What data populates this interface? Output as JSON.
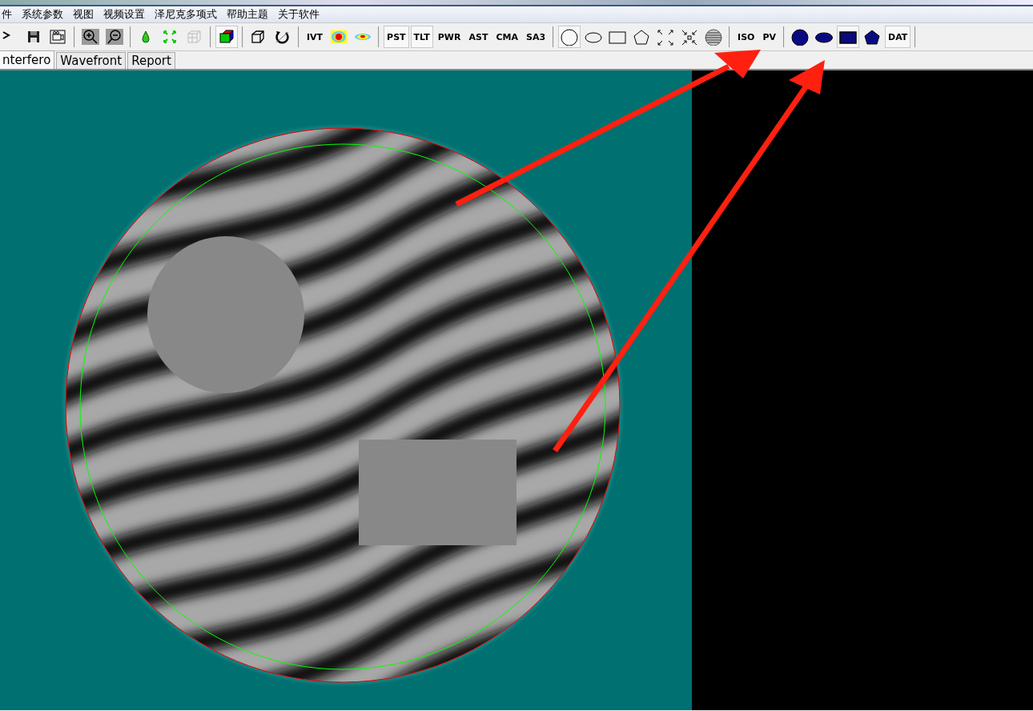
{
  "menu": [
    "件",
    "系统参数",
    "视图",
    "视频设置",
    "泽尼克多项式",
    "帮助主题",
    "关于软件"
  ],
  "toolbar": [
    [
      {
        "kind": "cursor",
        "pressed": false
      },
      {
        "kind": "save",
        "pressed": false
      },
      {
        "kind": "camera",
        "pressed": false
      }
    ],
    [
      {
        "kind": "zoomin",
        "pressed": false
      },
      {
        "kind": "zoomout",
        "pressed": false
      }
    ],
    [
      {
        "kind": "drop",
        "pressed": false
      },
      {
        "kind": "expand",
        "pressed": false
      },
      {
        "kind": "mesh",
        "pressed": false
      }
    ],
    [
      {
        "kind": "cube",
        "pressed": true
      }
    ],
    [
      {
        "kind": "box",
        "pressed": false
      },
      {
        "kind": "rotate",
        "pressed": false
      }
    ],
    [
      {
        "kind": "text",
        "label": "IVT",
        "pressed": false
      },
      {
        "kind": "map",
        "pressed": false
      },
      {
        "kind": "blob",
        "pressed": false
      }
    ],
    [
      {
        "kind": "text",
        "label": "PST",
        "pressed": true
      },
      {
        "kind": "text",
        "label": "TLT",
        "pressed": true
      },
      {
        "kind": "text",
        "label": "PWR",
        "pressed": false
      },
      {
        "kind": "text",
        "label": "AST",
        "pressed": false
      },
      {
        "kind": "text",
        "label": "CMA",
        "pressed": false
      },
      {
        "kind": "text",
        "label": "SA3",
        "pressed": false
      }
    ],
    [
      {
        "kind": "circle",
        "pressed": true
      },
      {
        "kind": "ellipse",
        "pressed": false
      },
      {
        "kind": "rect",
        "pressed": false
      },
      {
        "kind": "pentagon",
        "pressed": false
      },
      {
        "kind": "grow",
        "pressed": false
      },
      {
        "kind": "shrink",
        "pressed": false
      },
      {
        "kind": "globe",
        "pressed": false
      }
    ],
    [
      {
        "kind": "text",
        "label": "ISO",
        "pressed": false
      },
      {
        "kind": "text",
        "label": "PV",
        "pressed": false
      }
    ],
    [
      {
        "kind": "disc",
        "pressed": false
      },
      {
        "kind": "oval",
        "pressed": false
      },
      {
        "kind": "block",
        "pressed": true
      },
      {
        "kind": "gem",
        "pressed": false
      },
      {
        "kind": "text",
        "label": "DAT",
        "pressed": true
      }
    ]
  ],
  "tabs": [
    {
      "label": "nterfero",
      "selected": true
    },
    {
      "label": "Wavefront",
      "selected": false
    },
    {
      "label": "Report",
      "selected": false
    }
  ]
}
